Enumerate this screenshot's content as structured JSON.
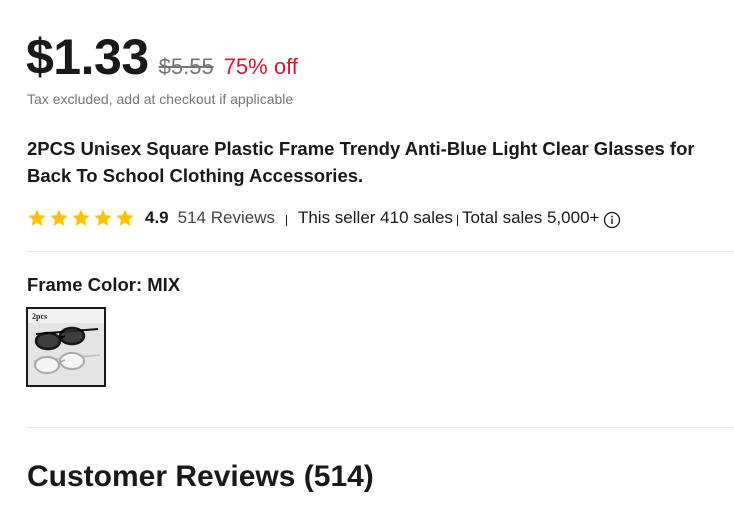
{
  "price": {
    "current": "$1.33",
    "original": "$5.55",
    "discount": "75% off",
    "tax_note": "Tax excluded, add at checkout if applicable",
    "discount_color": "#c41e3a"
  },
  "product": {
    "title": "2PCS Unisex Square Plastic Frame Trendy Anti-Blue Light Clear Glasses for Back To School Clothing Accessories."
  },
  "rating": {
    "stars": 5,
    "value": "4.9",
    "reviews": "514 Reviews",
    "seller_sales": "This seller 410 sales",
    "total_sales": "Total sales 5,000+",
    "star_color": "#fdc300",
    "info_icon": "info-icon"
  },
  "variant": {
    "label": "Frame Color: MIX",
    "options": [
      {
        "name": "MIX",
        "image_text": "2pcs",
        "selected": true
      }
    ]
  },
  "reviews_section": {
    "heading": "Customer Reviews (514)"
  }
}
